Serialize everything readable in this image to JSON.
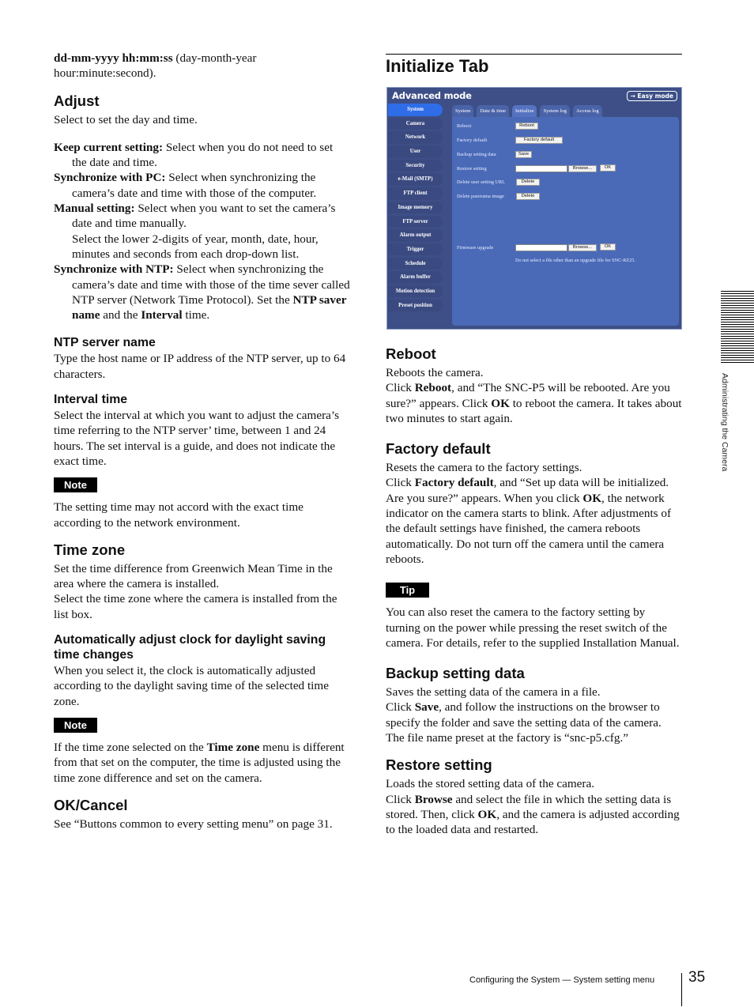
{
  "left": {
    "intro": {
      "bold": "dd-mm-yyyy hh:mm:ss",
      "rest": " (day-month-year hour:minute:second)."
    },
    "adjust": {
      "heading": "Adjust",
      "intro": "Select to set the day and time.",
      "items": [
        {
          "term": "Keep current setting:",
          "text": " Select when you do not need to set the date and time."
        },
        {
          "term": "Synchronize with PC:",
          "text": " Select when synchronizing the camera’s date and time with those of the computer."
        },
        {
          "term": "Manual setting:",
          "text": " Select when you want to set the camera’s date and time manually.",
          "extra": "Select the lower 2-digits of year, month, date, hour, minutes and seconds from each drop-down list."
        },
        {
          "term": "Synchronize with NTP:",
          "text": " Select when synchronizing the camera’s date and time with those of the time sever called NTP server (Network Time Protocol). Set the ",
          "b1": "NTP saver name",
          "mid": " and the ",
          "b2": "Interval",
          "end": " time."
        }
      ]
    },
    "ntp": {
      "heading": "NTP server name",
      "text": "Type the host name or IP address of the NTP server, up to 64 characters."
    },
    "interval": {
      "heading": "Interval time",
      "text": "Select the interval at which you want to adjust the camera’s time referring to the NTP server’ time, between 1 and 24 hours.  The set interval is a guide, and does not indicate the exact time."
    },
    "note1": {
      "label": "Note",
      "text": "The setting time may not accord with the exact time according to the network environment."
    },
    "timezone": {
      "heading": "Time zone",
      "text1": "Set the time difference from Greenwich Mean Time in the area where the camera is installed.",
      "text2": "Select the time zone where the camera is installed from the list box."
    },
    "dst": {
      "heading": "Automatically adjust clock for daylight saving time changes",
      "text": "When you select it, the clock is automatically adjusted according to the daylight saving time of the selected time zone."
    },
    "note2": {
      "label": "Note",
      "pre": "If the time zone selected on the ",
      "bold": "Time zone",
      "post": " menu is different from that set on the computer, the time is adjusted using the time zone difference and set on the camera."
    },
    "okcancel": {
      "heading": "OK/Cancel",
      "text": "See “Buttons common to every setting menu” on page 31."
    }
  },
  "right": {
    "title": "Initialize Tab",
    "screenshot": {
      "mode_title": "Advanced mode",
      "easy_mode": "→ Easy mode",
      "sidebar": [
        "System",
        "Camera",
        "Network",
        "User",
        "Security",
        "e-Mail (SMTP)",
        "FTP client",
        "Image memory",
        "FTP server",
        "Alarm output",
        "Trigger",
        "Schedule",
        "Alarm buffer",
        "Motion detection",
        "Preset position"
      ],
      "active_sidebar": "System",
      "tabs": [
        "System",
        "Date & time",
        "Initialize",
        "System log",
        "Access log"
      ],
      "active_tab": "Initialize",
      "rows": {
        "reboot": {
          "label": "Reboot",
          "button": "Reboot"
        },
        "factory": {
          "label": "Factory default",
          "button": "Factory default"
        },
        "backup": {
          "label": "Backup setting data",
          "button": "Save"
        },
        "restore": {
          "label": "Restore setting",
          "browse": "Browse...",
          "ok": "OK"
        },
        "delete_url": {
          "label": "Delete user setting URL",
          "button": "Delete"
        },
        "delete_pano": {
          "label": "Delete panorama image",
          "button": "Delete"
        },
        "firmware": {
          "label": "Firmware upgrade",
          "browse": "Browse...",
          "ok": "OK"
        }
      },
      "firmware_hint": "Do not select a file other than an upgrade file for SNC-RZ25."
    },
    "reboot": {
      "heading": "Reboot",
      "t1": "Reboots the camera.",
      "t2a": "Click ",
      "t2b": "Reboot",
      "t2c": ", and “The SNC-P5 will be rebooted.  Are you sure?” appears.  Click ",
      "t2d": "OK",
      "t2e": " to reboot the camera.  It takes about two minutes to start again."
    },
    "factory": {
      "heading": "Factory default",
      "t1": "Resets the camera to the factory settings.",
      "t2a": "Click ",
      "t2b": "Factory default",
      "t2c": ", and “Set up data will be initialized.  Are you sure?” appears.   When you click ",
      "t2d": "OK",
      "t2e": ", the network indicator on the camera starts to blink. After adjustments of the default settings have finished, the camera reboots automatically. Do not turn off the camera until the camera reboots."
    },
    "tip": {
      "label": "Tip",
      "text": "You can also reset the camera to the factory setting by turning on the power while pressing the reset switch of the camera. For details, refer to the supplied Installation Manual."
    },
    "backup": {
      "heading": "Backup setting data",
      "t1": "Saves the setting data of the camera in a file.",
      "t2a": "Click ",
      "t2b": "Save",
      "t2c": ", and follow the instructions on the browser to specify the folder and save the setting data of the camera. The file name preset at the factory is “snc-p5.cfg.”"
    },
    "restore": {
      "heading": "Restore setting",
      "t1": "Loads the stored setting data of the camera.",
      "t2a": "Click ",
      "t2b": "Browse",
      "t2c": " and select the file in which the setting data is stored. Then, click ",
      "t2d": "OK",
      "t2e": ", and the camera is adjusted according to the loaded data and restarted."
    }
  },
  "margin": {
    "section_tab": "Administrating the Camera"
  },
  "footer": {
    "text": "Configuring the System — System setting menu",
    "page": "35"
  }
}
